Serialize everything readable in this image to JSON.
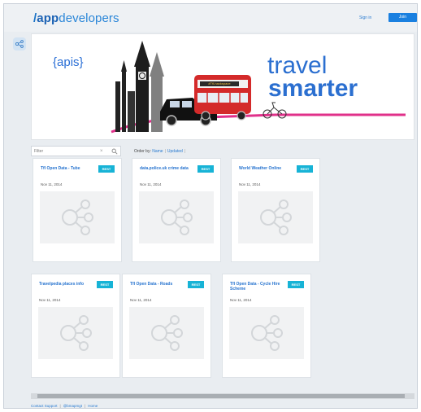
{
  "header": {
    "logo_slash": "/",
    "logo_app": "app",
    "logo_dev": "developers",
    "signin_label": "Sign in",
    "join_label": "Join"
  },
  "banner": {
    "apis_text": "{apis}",
    "travel_text": "travel",
    "smarter_text": "smarter",
    "bus_text": "#TfLhackspace"
  },
  "filter": {
    "placeholder": "Filter",
    "clear_glyph": "×",
    "order_label": "Order by:",
    "order_name": "Name",
    "order_updated": "Updated"
  },
  "cards": [
    {
      "title": "Tfl Open Data - Tube",
      "badge": "REST",
      "date": "Nov 11, 2014"
    },
    {
      "title": "data.police.uk crime data",
      "badge": "REST",
      "date": "Nov 11, 2014"
    },
    {
      "title": "World Weather Online",
      "badge": "REST",
      "date": "Nov 11, 2014"
    },
    {
      "title": "Travelpedia places info",
      "badge": "REST",
      "date": "Nov 11, 2014"
    },
    {
      "title": "Tfl Open Data - Roads",
      "badge": "REST",
      "date": "Nov 11, 2014"
    },
    {
      "title": "Tfl Open Data - Cycle Hire Scheme",
      "badge": "REST",
      "date": "Nov 11, 2014"
    }
  ],
  "footer": {
    "contact": "Contact Support",
    "twitter": "@bmapmgt",
    "home": "Home"
  },
  "colors": {
    "brand_blue": "#1a73c7",
    "badge_cyan": "#17b3d6",
    "join_blue": "#1a80e0",
    "banner_pink": "#e0308a"
  },
  "icons": {
    "side": "share-nodes-icon",
    "search": "search-icon",
    "placeholder": "api-nodes-placeholder-icon"
  }
}
